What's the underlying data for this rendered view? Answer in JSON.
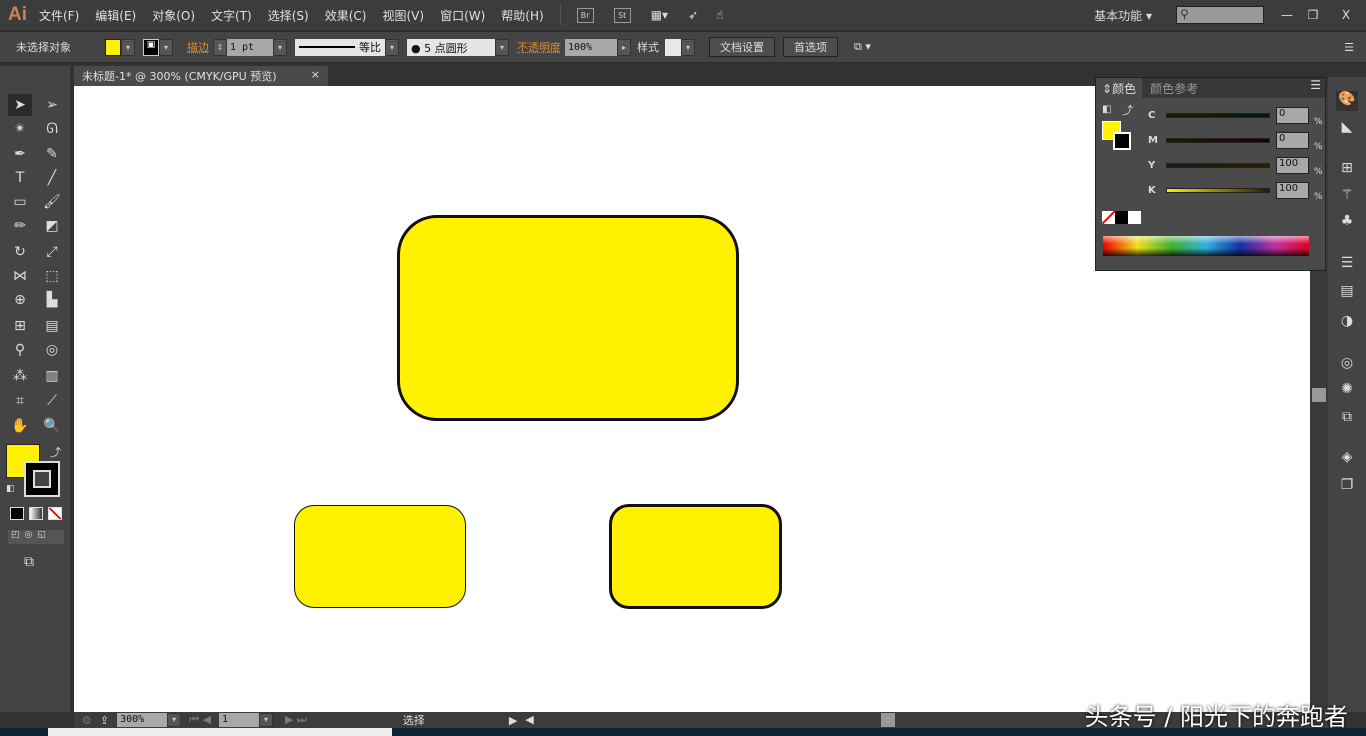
{
  "app": {
    "logo": "Ai",
    "menus": [
      "文件(F)",
      "编辑(E)",
      "对象(O)",
      "文字(T)",
      "选择(S)",
      "效果(C)",
      "视图(V)",
      "窗口(W)",
      "帮助(H)"
    ],
    "bridge": "Br",
    "stock": "St",
    "workspace": "基本功能"
  },
  "control": {
    "selection": "未选择对象",
    "fill_color": "#fff100",
    "stroke_label": "描边",
    "stroke_weight": "1 pt",
    "profile": "等比",
    "brush": "5 点圆形",
    "opacity_label": "不透明度",
    "opacity": "100%",
    "style_label": "样式",
    "doc_setup": "文档设置",
    "preferences": "首选项"
  },
  "document": {
    "tab": "未标题-1* @ 300% (CMYK/GPU 预览)",
    "close": "×",
    "shape_fill": "#fff100"
  },
  "status": {
    "zoom": "300%",
    "artboard": "1",
    "mode": "选择"
  },
  "color_panel": {
    "tabs": [
      "颜色",
      "颜色参考"
    ],
    "channels": [
      {
        "name": "C",
        "value": "0"
      },
      {
        "name": "M",
        "value": "0"
      },
      {
        "name": "Y",
        "value": "100"
      },
      {
        "name": "K",
        "value": "100"
      }
    ],
    "pct": "%"
  },
  "watermark": "头条号 / 阳光下的奔跑者"
}
